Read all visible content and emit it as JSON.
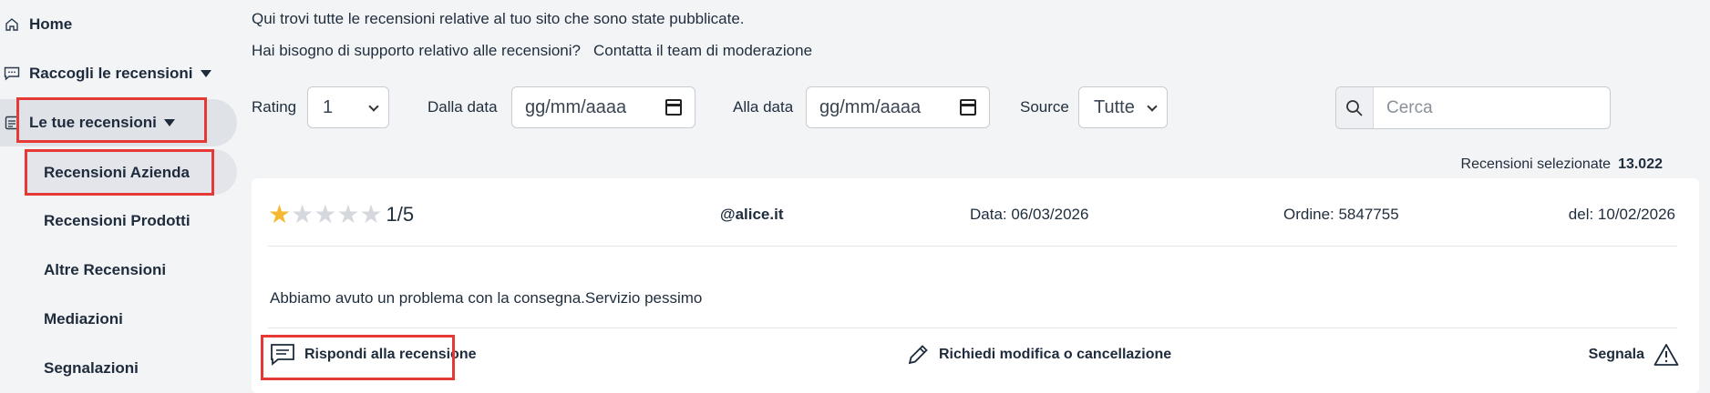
{
  "sidebar": {
    "items": [
      {
        "label": "Home",
        "icon": "home-icon"
      },
      {
        "label": "Raccogli le recensioni",
        "icon": "chat-icon"
      },
      {
        "label": "Le tue recensioni",
        "icon": "list-icon"
      }
    ],
    "subitems": [
      {
        "label": "Recensioni Azienda"
      },
      {
        "label": "Recensioni Prodotti"
      },
      {
        "label": "Altre Recensioni"
      },
      {
        "label": "Mediazioni"
      },
      {
        "label": "Segnalazioni"
      }
    ]
  },
  "intro": {
    "line1": "Qui trovi tutte le recensioni relative al tuo sito che sono state pubblicate.",
    "line2": "Hai bisogno di supporto relativo alle recensioni?",
    "link": "Contatta il team di moderazione"
  },
  "filters": {
    "rating_label": "Rating",
    "rating_value": "1",
    "from_label": "Dalla data",
    "from_value": "gg/mm/aaaa",
    "to_label": "Alla data",
    "to_value": "gg/mm/aaaa",
    "source_label": "Source",
    "source_value": "Tutte",
    "search_placeholder": "Cerca"
  },
  "selected": {
    "label": "Recensioni selezionate",
    "count": "13.022"
  },
  "review": {
    "stars_filled": 1,
    "stars_total": 5,
    "rating_text": "1/5",
    "email": "@alice.it",
    "date": "Data: 06/03/2026",
    "order": "Ordine: 5847755",
    "del": "del: 10/02/2026",
    "text": "Abbiamo avuto un problema con la consegna.Servizio pessimo",
    "actions": {
      "reply": "Rispondi alla recensione",
      "edit": "Richiedi modifica o cancellazione",
      "report": "Segnala"
    }
  },
  "colors": {
    "accent_red": "#e53935",
    "star": "#f5b830",
    "text": "#1f2d3d"
  }
}
